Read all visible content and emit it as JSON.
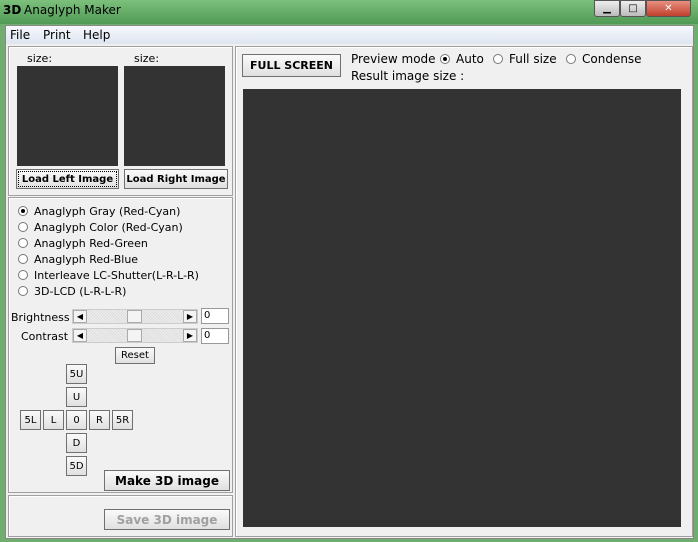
{
  "window": {
    "title": "Anaglyph Maker",
    "logo": "3D"
  },
  "menu": [
    "File",
    "Print",
    "Help"
  ],
  "left": {
    "size_label_left": "size:",
    "size_label_right": "size:",
    "load_left": "Load Left Image",
    "load_right": "Load Right Image"
  },
  "modes": [
    {
      "label": "Anaglyph Gray (Red-Cyan)",
      "checked": true
    },
    {
      "label": "Anaglyph Color (Red-Cyan)",
      "checked": false
    },
    {
      "label": "Anaglyph Red-Green",
      "checked": false
    },
    {
      "label": "Anaglyph Red-Blue",
      "checked": false
    },
    {
      "label": "Interleave LC-Shutter(L-R-L-R)",
      "checked": false
    },
    {
      "label": "3D-LCD (L-R-L-R)",
      "checked": false
    }
  ],
  "adjust": {
    "brightness_label": "Brightness",
    "brightness_value": "0",
    "contrast_label": "Contrast",
    "contrast_value": "0",
    "reset": "Reset"
  },
  "shift": {
    "up5": "5U",
    "up": "U",
    "left5": "5L",
    "left": "L",
    "zero": "0",
    "right": "R",
    "right5": "5R",
    "down": "D",
    "down5": "5D"
  },
  "make": "Make 3D image",
  "save": "Save 3D image",
  "preview": {
    "fullscreen": "FULL SCREEN",
    "mode_label": "Preview mode",
    "options": [
      "Auto",
      "Full size",
      "Condense"
    ],
    "selected": "Auto",
    "result_label": "Result image size :"
  }
}
